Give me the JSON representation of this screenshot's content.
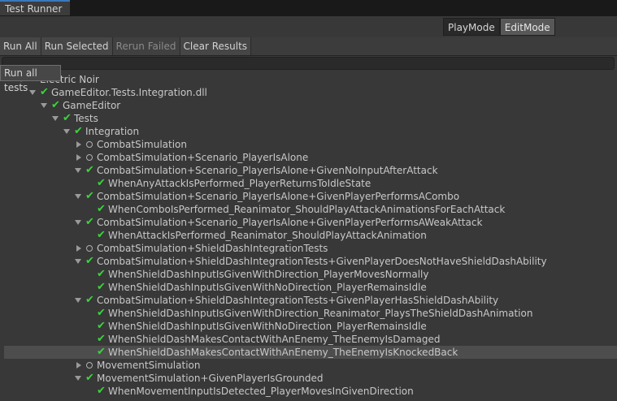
{
  "window": {
    "tab_title": "Test Runner"
  },
  "modes": {
    "play": "PlayMode",
    "edit": "EditMode"
  },
  "toolbar": {
    "run_all": "Run All",
    "run_selected": "Run Selected",
    "rerun_failed": "Rerun Failed",
    "clear_results": "Clear Results"
  },
  "search": {
    "value": ""
  },
  "tooltip": {
    "text": "Run all tests"
  },
  "tree": [
    {
      "depth": 0,
      "label": "Electric Noir",
      "expanded": true,
      "status": "passed",
      "selected": false
    },
    {
      "depth": 1,
      "label": "GameEditor.Tests.Integration.dll",
      "expanded": true,
      "status": "passed",
      "selected": false
    },
    {
      "depth": 2,
      "label": "GameEditor",
      "expanded": true,
      "status": "passed",
      "selected": false
    },
    {
      "depth": 3,
      "label": "Tests",
      "expanded": true,
      "status": "passed",
      "selected": false
    },
    {
      "depth": 4,
      "label": "Integration",
      "expanded": true,
      "status": "passed",
      "selected": false
    },
    {
      "depth": 5,
      "label": "CombatSimulation",
      "expanded": false,
      "status": "not-run",
      "selected": false
    },
    {
      "depth": 5,
      "label": "CombatSimulation+Scenario_PlayerIsAlone",
      "expanded": false,
      "status": "not-run",
      "selected": false
    },
    {
      "depth": 5,
      "label": "CombatSimulation+Scenario_PlayerIsAlone+GivenNoInputAfterAttack",
      "expanded": true,
      "status": "passed",
      "selected": false
    },
    {
      "depth": 6,
      "label": "WhenAnyAttackIsPerformed_PlayerReturnsToIdleState",
      "leaf": true,
      "status": "passed",
      "selected": false
    },
    {
      "depth": 5,
      "label": "CombatSimulation+Scenario_PlayerIsAlone+GivenPlayerPerformsACombo",
      "expanded": true,
      "status": "passed",
      "selected": false
    },
    {
      "depth": 6,
      "label": "WhenComboIsPerformed_Reanimator_ShouldPlayAttackAnimationsForEachAttack",
      "leaf": true,
      "status": "passed",
      "selected": false
    },
    {
      "depth": 5,
      "label": "CombatSimulation+Scenario_PlayerIsAlone+GivenPlayerPerformsAWeakAttack",
      "expanded": true,
      "status": "passed",
      "selected": false
    },
    {
      "depth": 6,
      "label": "WhenAttackIsPerformed_Reanimator_ShouldPlayAttackAnimation",
      "leaf": true,
      "status": "passed",
      "selected": false
    },
    {
      "depth": 5,
      "label": "CombatSimulation+ShieldDashIntegrationTests",
      "expanded": false,
      "status": "not-run",
      "selected": false
    },
    {
      "depth": 5,
      "label": "CombatSimulation+ShieldDashIntegrationTests+GivenPlayerDoesNotHaveShieldDashAbility",
      "expanded": true,
      "status": "passed",
      "selected": false
    },
    {
      "depth": 6,
      "label": "WhenShieldDashInputIsGivenWithDirection_PlayerMovesNormally",
      "leaf": true,
      "status": "passed",
      "selected": false
    },
    {
      "depth": 6,
      "label": "WhenShieldDashInputIsGivenWithNoDirection_PlayerRemainsIdle",
      "leaf": true,
      "status": "passed",
      "selected": false
    },
    {
      "depth": 5,
      "label": "CombatSimulation+ShieldDashIntegrationTests+GivenPlayerHasShieldDashAbility",
      "expanded": true,
      "status": "passed",
      "selected": false
    },
    {
      "depth": 6,
      "label": "WhenShieldDashInputIsGivenWithDirection_Reanimator_PlaysTheShieldDashAnimation",
      "leaf": true,
      "status": "passed",
      "selected": false
    },
    {
      "depth": 6,
      "label": "WhenShieldDashInputIsGivenWithNoDirection_PlayerRemainsIdle",
      "leaf": true,
      "status": "passed",
      "selected": false
    },
    {
      "depth": 6,
      "label": "WhenShieldDashMakesContactWithAnEnemy_TheEnemyIsDamaged",
      "leaf": true,
      "status": "passed",
      "selected": false
    },
    {
      "depth": 6,
      "label": "WhenShieldDashMakesContactWithAnEnemy_TheEnemyIsKnockedBack",
      "leaf": true,
      "status": "passed",
      "selected": true
    },
    {
      "depth": 5,
      "label": "MovementSimulation",
      "expanded": false,
      "status": "not-run",
      "selected": false
    },
    {
      "depth": 5,
      "label": "MovementSimulation+GivenPlayerIsGrounded",
      "expanded": true,
      "status": "passed",
      "selected": false
    },
    {
      "depth": 6,
      "label": "WhenMovementInputIsDetected_PlayerMovesInGivenDirection",
      "leaf": true,
      "status": "passed",
      "selected": false
    }
  ]
}
